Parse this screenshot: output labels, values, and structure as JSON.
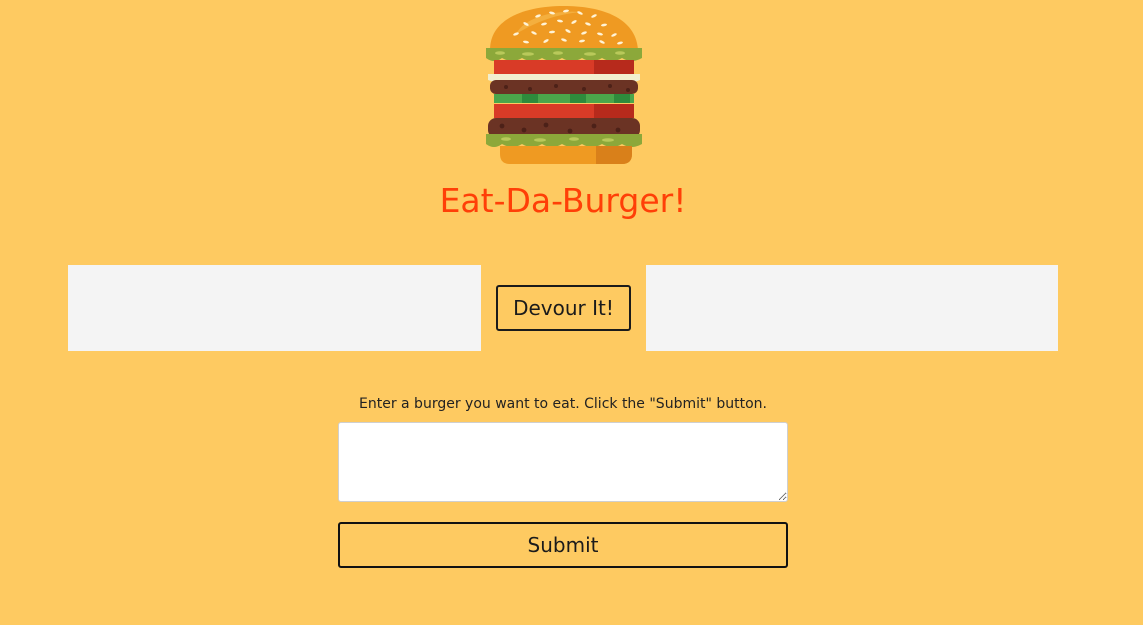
{
  "header": {
    "logo_icon": "burger-icon",
    "title": "Eat-Da-Burger!"
  },
  "main": {
    "devour_label": "Devour It!",
    "instructions": "Enter a burger you want to eat. Click the \"Submit\" button.",
    "burger_input": {
      "value": "",
      "placeholder": ""
    },
    "submit_label": "Submit"
  },
  "colors": {
    "background": "#FECA61",
    "title": "#FF3F07",
    "panel": "#F4F4F4"
  }
}
